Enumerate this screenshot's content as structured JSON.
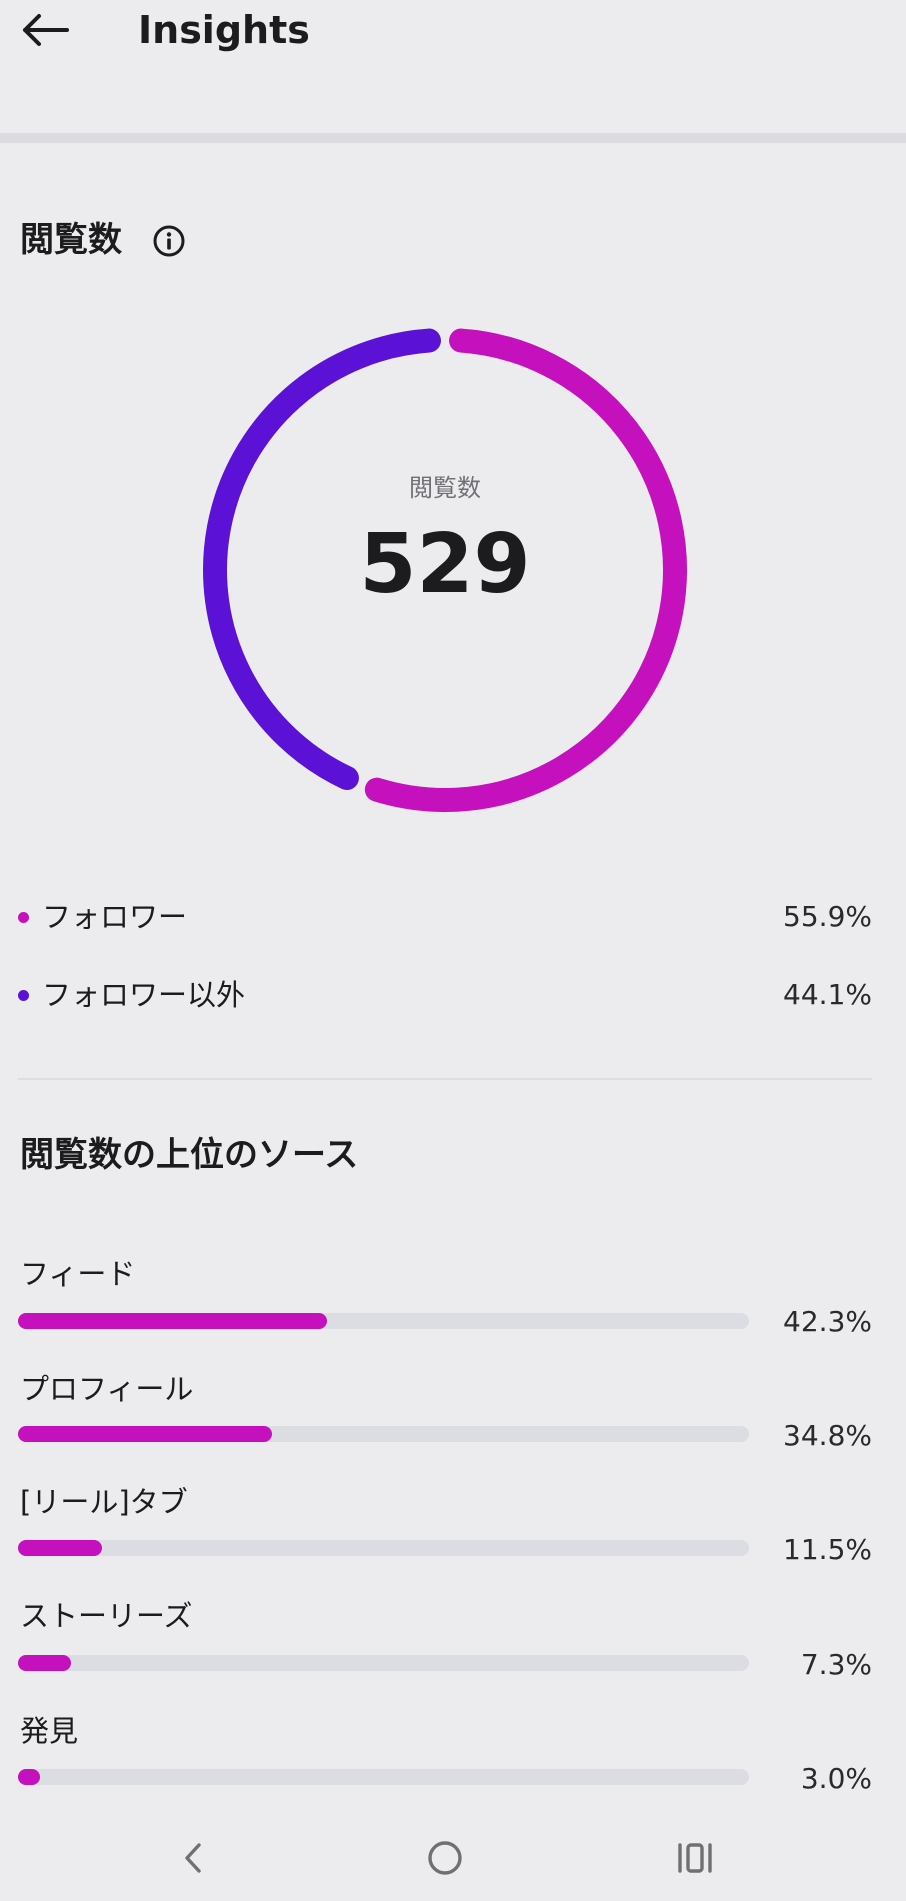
{
  "header": {
    "title": "Insights",
    "back_icon": "arrow-left-icon"
  },
  "views": {
    "title": "閲覧数",
    "info_icon": "info-icon",
    "center_label": "閲覧数",
    "total": "529",
    "colors": {
      "followers": "#c511bd",
      "non_followers": "#5b12d6"
    },
    "legend": [
      {
        "label": "フォロワー",
        "value": "55.9%",
        "color": "#c511bd",
        "fraction": 0.559
      },
      {
        "label": "フォロワー以外",
        "value": "44.1%",
        "color": "#5b12d6",
        "fraction": 0.441
      }
    ]
  },
  "top_sources": {
    "title": "閲覧数の上位のソース",
    "items": [
      {
        "label": "フィード",
        "value": "42.3%",
        "fraction": 0.423
      },
      {
        "label": "プロフィール",
        "value": "34.8%",
        "fraction": 0.348
      },
      {
        "label": "[リール]タブ",
        "value": "11.5%",
        "fraction": 0.115
      },
      {
        "label": "ストーリーズ",
        "value": "7.3%",
        "fraction": 0.073
      },
      {
        "label": "発見",
        "value": "3.0%",
        "fraction": 0.03
      }
    ]
  },
  "navbar": {
    "back_icon": "nav-back-icon",
    "home_icon": "nav-home-icon",
    "recents_icon": "nav-recents-icon"
  }
}
